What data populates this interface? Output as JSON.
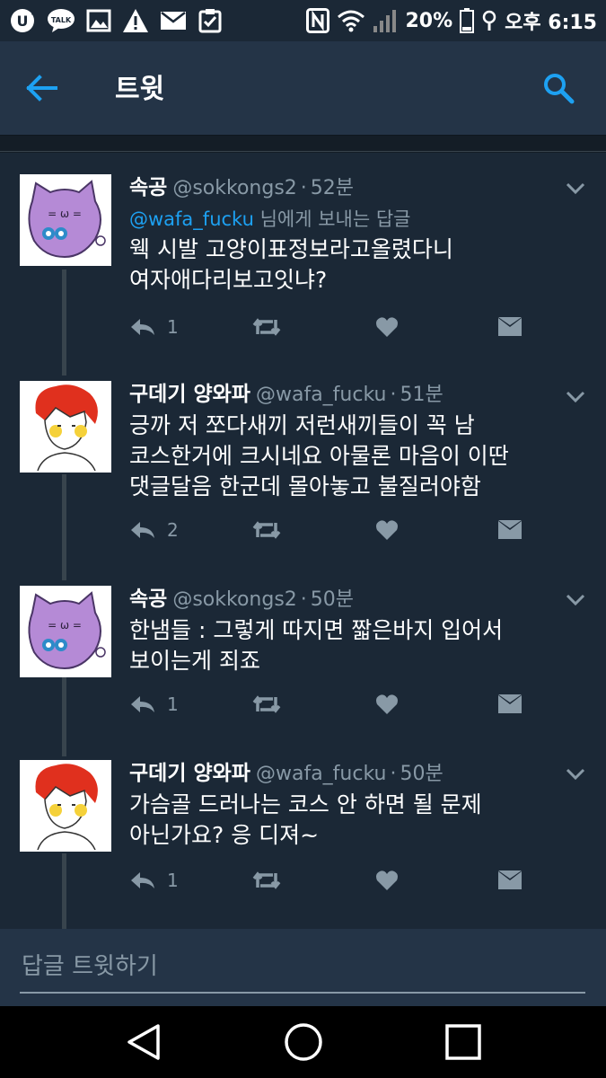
{
  "status_bar": {
    "battery": "20%",
    "time": "오후 6:15",
    "left_icons": [
      "carrier-icon",
      "kakaotalk-icon",
      "gallery-icon",
      "warning-icon",
      "mail-icon",
      "clipboard-check-icon"
    ],
    "right_icons": [
      "nfc-icon",
      "wifi-icon",
      "signal-icon",
      "battery-icon",
      "alarm-icon"
    ]
  },
  "app_bar": {
    "title": "트윗",
    "back_icon": "back-arrow-icon",
    "search_icon": "search-icon",
    "accent_color": "#1da1f2"
  },
  "tweets": [
    {
      "author_name": "속공",
      "handle": "@sokkongs2",
      "time": "52분",
      "reply_mention": "@wafa_fucku",
      "reply_suffix": " 님에게 보내는 답글",
      "text": "웩 시발 고양이표정보라고올렸다니\n여자애다리보고잇냐?",
      "reply_count": "1",
      "avatar": "purple-cat-avatar"
    },
    {
      "author_name": "구데기 양와파",
      "handle": "@wafa_fucku",
      "time": "51분",
      "text": "긍까 저 쪼다새끼 저런새끼들이 꼭 남\n코스한거에 크시네요 아물론 마음이 이딴\n댓글달음 한군데 몰아놓고 불질러야함",
      "reply_count": "2",
      "avatar": "red-hair-boy-avatar"
    },
    {
      "author_name": "속공",
      "handle": "@sokkongs2",
      "time": "50분",
      "text": "한냄들 : 그렇게 따지면 짧은바지 입어서\n보이는게 죄죠",
      "reply_count": "1",
      "avatar": "purple-cat-avatar"
    },
    {
      "author_name": "구데기 양와파",
      "handle": "@wafa_fucku",
      "time": "50분",
      "text": "가슴골 드러나는 코스 안 하면 될 문제\n아닌가요? 응 디져~",
      "reply_count": "1",
      "avatar": "red-hair-boy-avatar"
    }
  ],
  "reply_bar": {
    "placeholder": "답글 트윗하기"
  },
  "nav_bar": {
    "buttons": [
      "back-triangle-icon",
      "home-circle-icon",
      "recents-square-icon"
    ]
  },
  "colors": {
    "background": "#1b2836",
    "header": "#243447",
    "muted": "#8899a6",
    "thread_line": "#38444d"
  }
}
